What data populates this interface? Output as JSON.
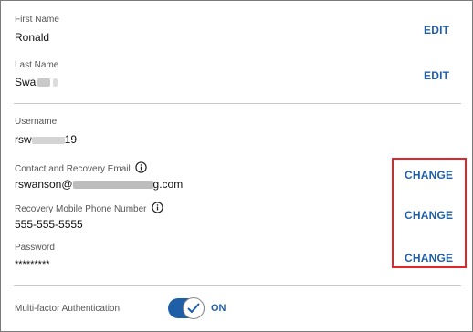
{
  "name_section": {
    "first_name": {
      "label": "First Name",
      "value": "Ronald",
      "action": "EDIT"
    },
    "last_name": {
      "label": "Last Name",
      "value": "Swa",
      "action": "EDIT"
    }
  },
  "account_section": {
    "username": {
      "label": "Username",
      "value_prefix": "rsw",
      "value_suffix": "19"
    },
    "email": {
      "label": "Contact and Recovery Email",
      "value_prefix": "rswanson@",
      "value_suffix": "g.com",
      "action": "CHANGE",
      "icon": "info-icon"
    },
    "phone": {
      "label": "Recovery Mobile Phone Number",
      "value": "555-555-5555",
      "action": "CHANGE",
      "icon": "info-icon"
    },
    "password": {
      "label": "Password",
      "value": "*********",
      "action": "CHANGE"
    }
  },
  "mfa": {
    "label": "Multi-factor Authentication",
    "state": "ON",
    "enabled": true
  },
  "colors": {
    "accent": "#1f5fa8",
    "highlight": "#e0262b",
    "divider": "#c8c8c8"
  }
}
